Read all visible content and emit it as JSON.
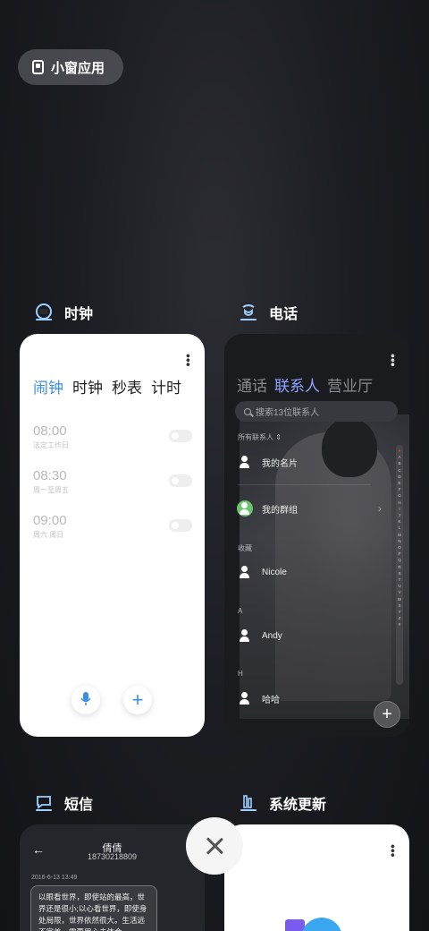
{
  "top_pill": {
    "label": "小窗应用",
    "icon": "floating-window-icon"
  },
  "apps": [
    {
      "name": "时钟",
      "icon": "clock-icon",
      "tabs": [
        "闹钟",
        "时钟",
        "秒表",
        "计时"
      ],
      "active_tab": "闹钟",
      "alarms": [
        {
          "time": "08:00",
          "repeat": "法定工作日",
          "enabled": false
        },
        {
          "time": "08:30",
          "repeat": "周一至周五",
          "enabled": false
        },
        {
          "time": "09:00",
          "repeat": "周六 周日",
          "enabled": false
        }
      ]
    },
    {
      "name": "电话",
      "icon": "phone-icon",
      "tabs": [
        "通话",
        "联系人",
        "营业厅"
      ],
      "active_tab": "联系人",
      "search_placeholder": "搜索13位联系人",
      "filter_label": "所有联系人 ⇕",
      "my_card": "我的名片",
      "my_groups": "我的群组",
      "sections": [
        {
          "header": "收藏",
          "contacts": [
            "Nicole"
          ]
        },
        {
          "header": "A",
          "contacts": [
            "Andy"
          ]
        },
        {
          "header": "H",
          "contacts": [
            "哈哈"
          ]
        }
      ],
      "index_letters": [
        "♥",
        "A",
        "B",
        "C",
        "D",
        "E",
        "F",
        "G",
        "H",
        "I",
        "J",
        "K",
        "L",
        "M",
        "N",
        "O",
        "P",
        "Q",
        "R",
        "S",
        "T",
        "U",
        "V",
        "W",
        "X",
        "Y",
        "Z",
        "#"
      ]
    },
    {
      "name": "短信",
      "icon": "message-icon",
      "contact_name": "倩倩",
      "contact_number": "18730218809",
      "date": "2016-6-13 13:49",
      "message": "以眼看世界，即使站的最高，世界还是很小;以心看世界，即使身处局限，世界依然很大。生活远不完美，需要用心去体会..."
    },
    {
      "name": "系统更新",
      "icon": "system-update-icon"
    }
  ]
}
